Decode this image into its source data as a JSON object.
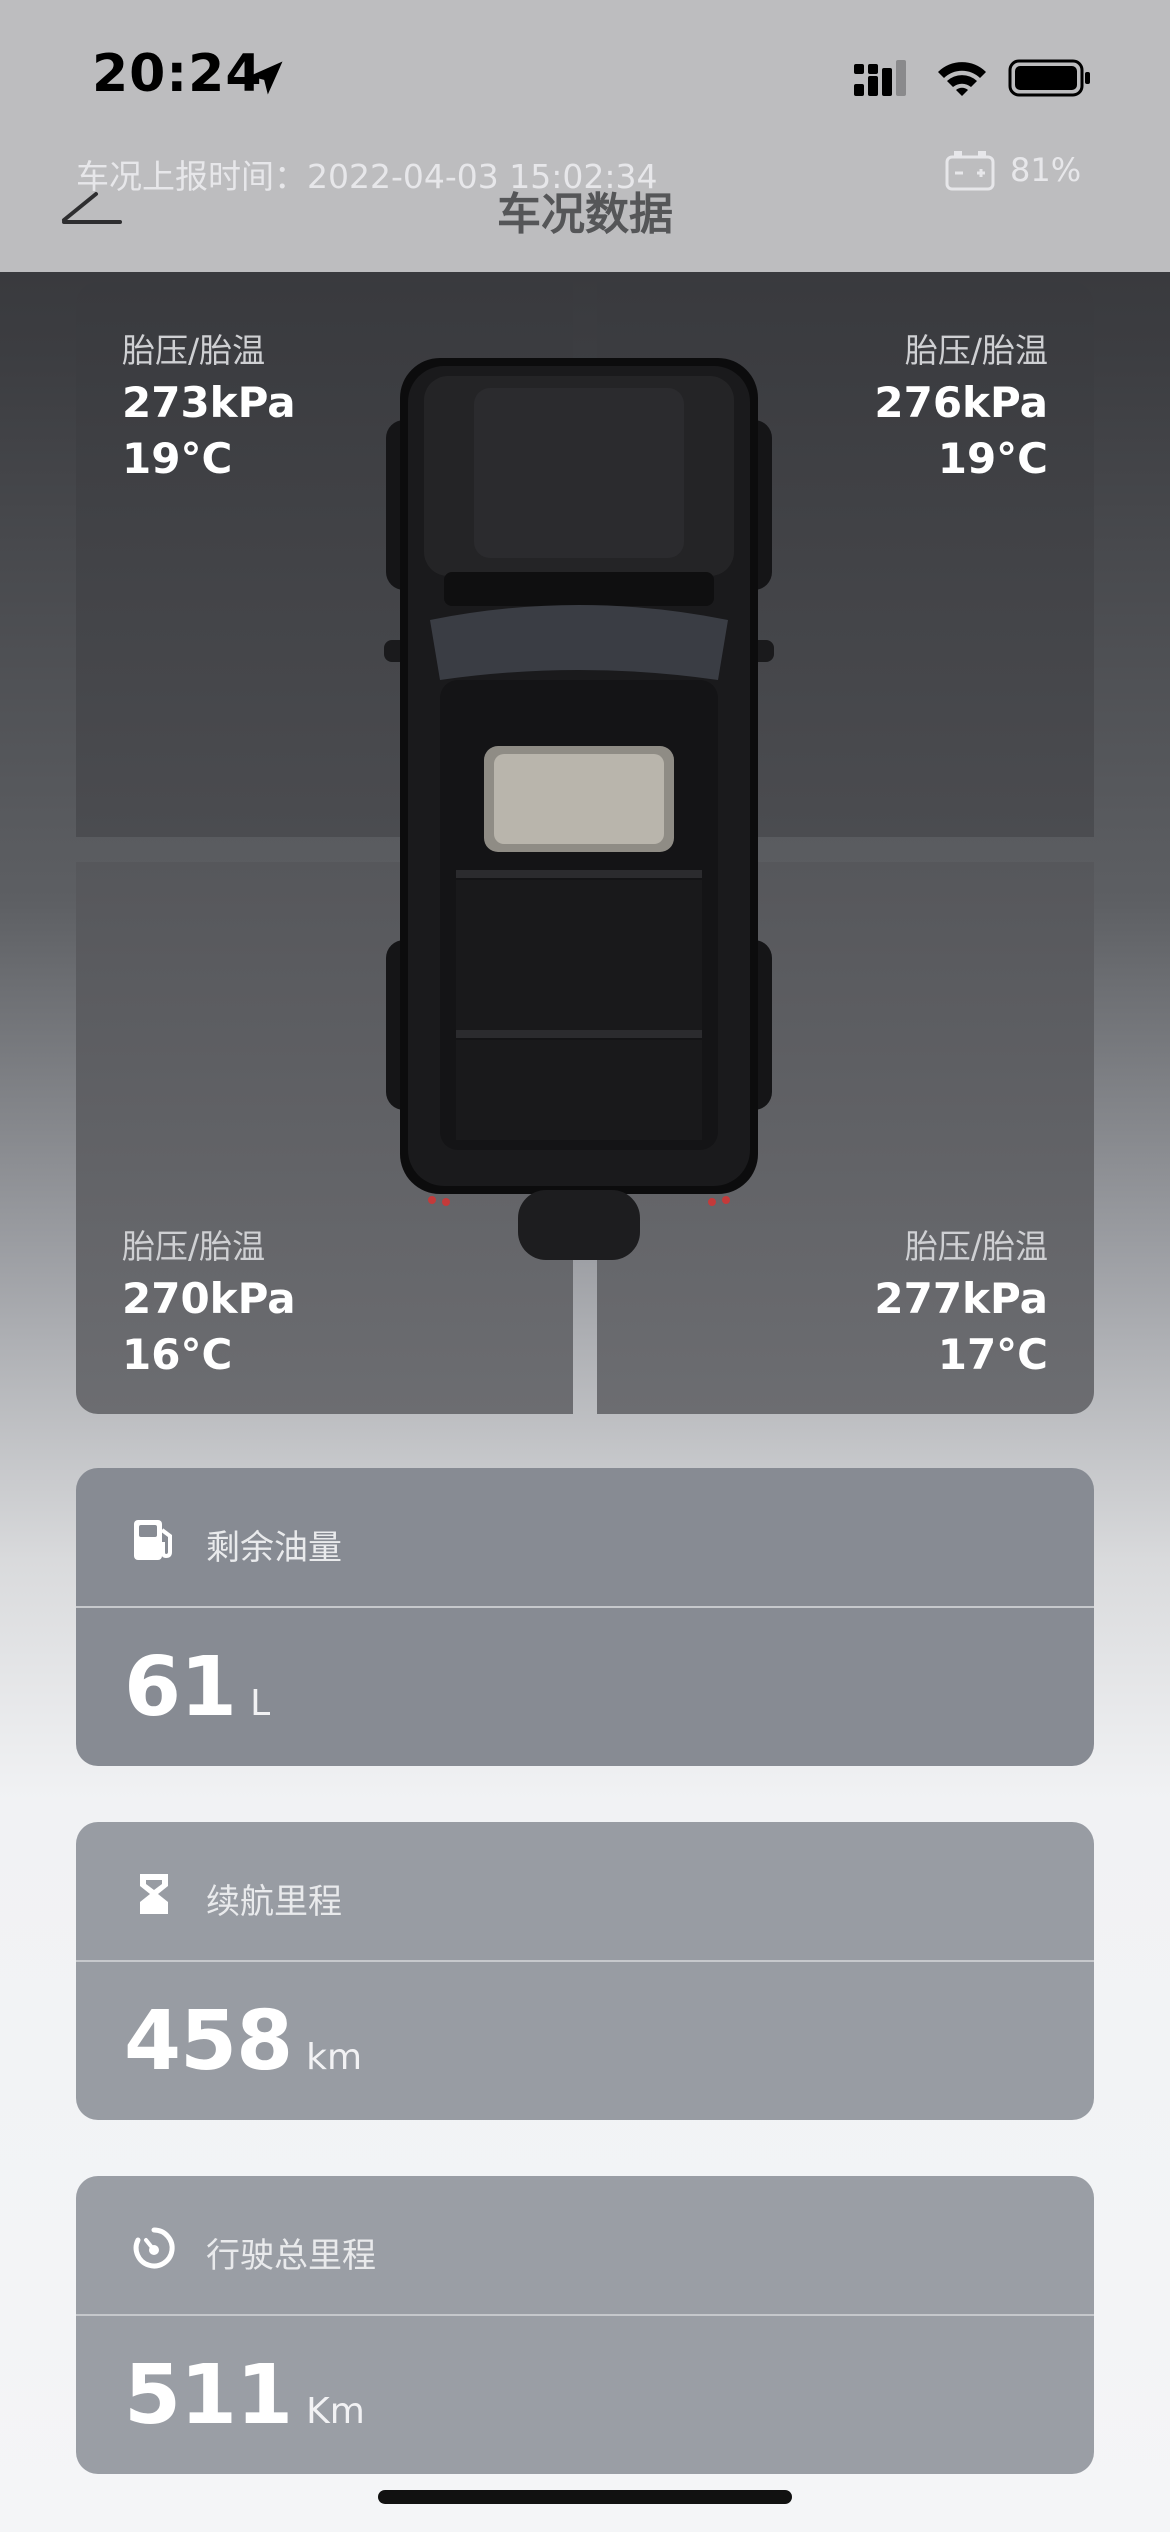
{
  "status_bar": {
    "time": "20:24"
  },
  "header": {
    "report_time": "车况上报时间：2022-04-03 15:02:34",
    "battery_percent": "81%",
    "title": "车况数据"
  },
  "tires": {
    "front_left": {
      "label": "胎压/胎温",
      "pressure": "273kPa",
      "temperature": "19°C"
    },
    "front_right": {
      "label": "胎压/胎温",
      "pressure": "276kPa",
      "temperature": "19°C"
    },
    "rear_left": {
      "label": "胎压/胎温",
      "pressure": "270kPa",
      "temperature": "16°C"
    },
    "rear_right": {
      "label": "胎压/胎温",
      "pressure": "277kPa",
      "temperature": "17°C"
    }
  },
  "cards": {
    "fuel": {
      "icon": "fuel-pump-icon",
      "title": "剩余油量",
      "value": "61",
      "unit": "L"
    },
    "range": {
      "icon": "hourglass-icon",
      "title": "续航里程",
      "value": "458",
      "unit": "km"
    },
    "odometer": {
      "icon": "odometer-icon",
      "title": "行驶总里程",
      "value": "511",
      "unit": "Km"
    }
  },
  "colors": {
    "header_bg": "#bdbdbf",
    "card_bg": "#8f939b"
  }
}
